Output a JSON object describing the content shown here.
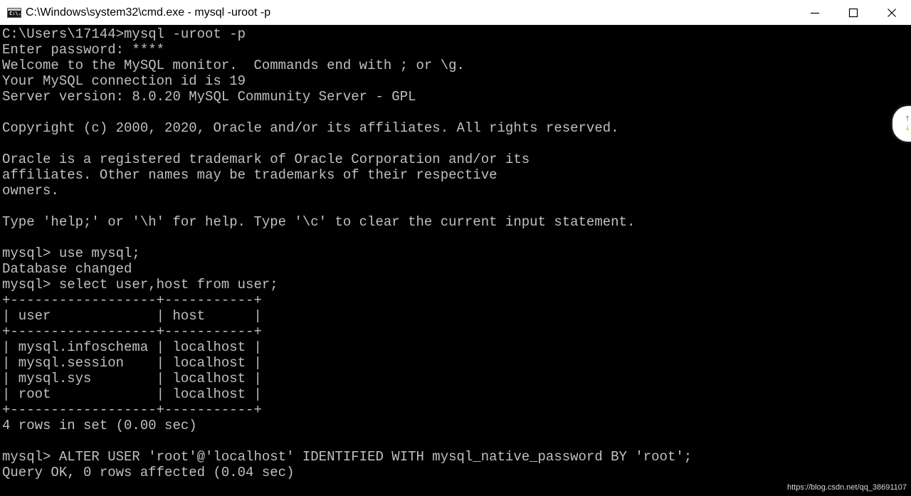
{
  "window": {
    "title": "C:\\Windows\\system32\\cmd.exe - mysql  -uroot -p",
    "icon": "cmd-icon",
    "icon_text": "C:\\."
  },
  "colors": {
    "console_bg": "#000000",
    "console_text": "#c0c0c0",
    "titlebar_bg": "#ffffff"
  },
  "console": {
    "lines": [
      "C:\\Users\\17144>mysql -uroot -p",
      "Enter password: ****",
      "Welcome to the MySQL monitor.  Commands end with ; or \\g.",
      "Your MySQL connection id is 19",
      "Server version: 8.0.20 MySQL Community Server - GPL",
      "",
      "Copyright (c) 2000, 2020, Oracle and/or its affiliates. All rights reserved.",
      "",
      "Oracle is a registered trademark of Oracle Corporation and/or its",
      "affiliates. Other names may be trademarks of their respective",
      "owners.",
      "",
      "Type 'help;' or '\\h' for help. Type '\\c' to clear the current input statement.",
      "",
      "mysql> use mysql;",
      "Database changed",
      "mysql> select user,host from user;",
      "+------------------+-----------+",
      "| user             | host      |",
      "+------------------+-----------+",
      "| mysql.infoschema | localhost |",
      "| mysql.session    | localhost |",
      "| mysql.sys        | localhost |",
      "| root             | localhost |",
      "+------------------+-----------+",
      "4 rows in set (0.00 sec)",
      "",
      "mysql> ALTER USER 'root'@'localhost' IDENTIFIED WITH mysql_native_password BY 'root';",
      "Query OK, 0 rows affected (0.04 sec)"
    ]
  },
  "scroll_widget": {
    "up_icon": "arrow-up-icon",
    "down_icon": "arrow-down-icon",
    "up_glyph": "↑",
    "down_glyph": "↓"
  },
  "watermark": {
    "text": "https://blog.csdn.net/qq_38691107"
  }
}
